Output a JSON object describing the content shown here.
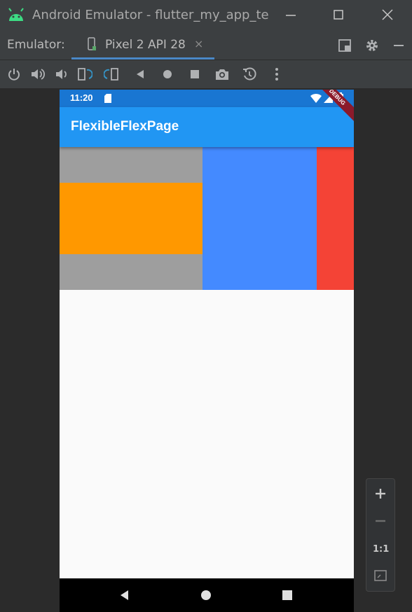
{
  "window": {
    "title": "Android Emulator - flutter_my_app_te"
  },
  "tabbar": {
    "label": "Emulator:",
    "tab_name": "Pixel 2 API 28",
    "tab_close": "×"
  },
  "toolbar_icons": [
    "power-icon",
    "volume-up-icon",
    "volume-down-icon",
    "rotate-left-icon",
    "rotate-right-icon",
    "back-icon",
    "home-icon",
    "overview-icon",
    "camera-icon",
    "snapshot-icon",
    "more-icon"
  ],
  "device": {
    "status_time": "11:20",
    "app_title": "FlexibleFlexPage",
    "debug_banner": "DEBUG"
  },
  "zoom": {
    "one_to_one": "1:1"
  },
  "colors": {
    "status_bar": "#1976d2",
    "app_bar": "#2196f3",
    "grey_box": "#9e9e9e",
    "orange_box": "#ff9800",
    "blue_box": "#448aff",
    "red_box": "#f44336"
  }
}
